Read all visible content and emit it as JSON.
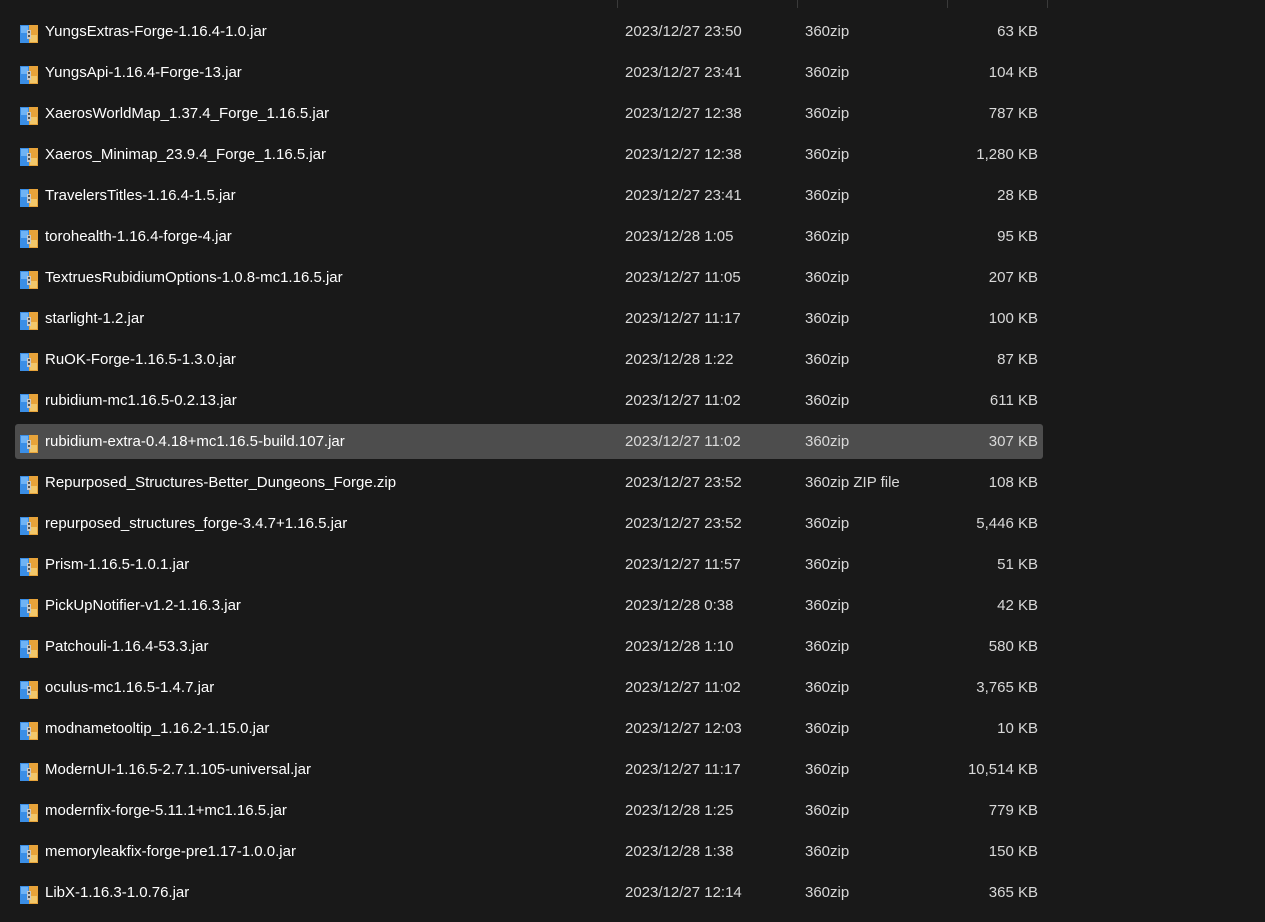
{
  "colors": {
    "background": "#191919",
    "selected_row": "#4d4d4d",
    "text_primary": "#ffffff",
    "text_secondary": "#d9d9d9"
  },
  "files": [
    {
      "name": "YungsExtras-Forge-1.16.4-1.0.jar",
      "date": "2023/12/27 23:50",
      "type": "360zip",
      "size": "63 KB",
      "icon": "archive-file-icon"
    },
    {
      "name": "YungsApi-1.16.4-Forge-13.jar",
      "date": "2023/12/27 23:41",
      "type": "360zip",
      "size": "104 KB",
      "icon": "archive-file-icon"
    },
    {
      "name": "XaerosWorldMap_1.37.4_Forge_1.16.5.jar",
      "date": "2023/12/27 12:38",
      "type": "360zip",
      "size": "787 KB",
      "icon": "archive-file-icon"
    },
    {
      "name": "Xaeros_Minimap_23.9.4_Forge_1.16.5.jar",
      "date": "2023/12/27 12:38",
      "type": "360zip",
      "size": "1,280 KB",
      "icon": "archive-file-icon"
    },
    {
      "name": "TravelersTitles-1.16.4-1.5.jar",
      "date": "2023/12/27 23:41",
      "type": "360zip",
      "size": "28 KB",
      "icon": "archive-file-icon"
    },
    {
      "name": "torohealth-1.16.4-forge-4.jar",
      "date": "2023/12/28 1:05",
      "type": "360zip",
      "size": "95 KB",
      "icon": "archive-file-icon"
    },
    {
      "name": "TextruesRubidiumOptions-1.0.8-mc1.16.5.jar",
      "date": "2023/12/27 11:05",
      "type": "360zip",
      "size": "207 KB",
      "icon": "archive-file-icon"
    },
    {
      "name": "starlight-1.2.jar",
      "date": "2023/12/27 11:17",
      "type": "360zip",
      "size": "100 KB",
      "icon": "archive-file-icon"
    },
    {
      "name": "RuOK-Forge-1.16.5-1.3.0.jar",
      "date": "2023/12/28 1:22",
      "type": "360zip",
      "size": "87 KB",
      "icon": "archive-file-icon"
    },
    {
      "name": "rubidium-mc1.16.5-0.2.13.jar",
      "date": "2023/12/27 11:02",
      "type": "360zip",
      "size": "611 KB",
      "icon": "archive-file-icon"
    },
    {
      "name": "rubidium-extra-0.4.18+mc1.16.5-build.107.jar",
      "date": "2023/12/27 11:02",
      "type": "360zip",
      "size": "307 KB",
      "icon": "archive-file-icon",
      "selected": true
    },
    {
      "name": "Repurposed_Structures-Better_Dungeons_Forge.zip",
      "date": "2023/12/27 23:52",
      "type": "360zip ZIP file",
      "size": "108 KB",
      "icon": "archive-file-icon"
    },
    {
      "name": "repurposed_structures_forge-3.4.7+1.16.5.jar",
      "date": "2023/12/27 23:52",
      "type": "360zip",
      "size": "5,446 KB",
      "icon": "archive-file-icon"
    },
    {
      "name": "Prism-1.16.5-1.0.1.jar",
      "date": "2023/12/27 11:57",
      "type": "360zip",
      "size": "51 KB",
      "icon": "archive-file-icon"
    },
    {
      "name": "PickUpNotifier-v1.2-1.16.3.jar",
      "date": "2023/12/28 0:38",
      "type": "360zip",
      "size": "42 KB",
      "icon": "archive-file-icon"
    },
    {
      "name": "Patchouli-1.16.4-53.3.jar",
      "date": "2023/12/28 1:10",
      "type": "360zip",
      "size": "580 KB",
      "icon": "archive-file-icon"
    },
    {
      "name": "oculus-mc1.16.5-1.4.7.jar",
      "date": "2023/12/27 11:02",
      "type": "360zip",
      "size": "3,765 KB",
      "icon": "archive-file-icon"
    },
    {
      "name": "modnametooltip_1.16.2-1.15.0.jar",
      "date": "2023/12/27 12:03",
      "type": "360zip",
      "size": "10 KB",
      "icon": "archive-file-icon"
    },
    {
      "name": "ModernUI-1.16.5-2.7.1.105-universal.jar",
      "date": "2023/12/27 11:17",
      "type": "360zip",
      "size": "10,514 KB",
      "icon": "archive-file-icon"
    },
    {
      "name": "modernfix-forge-5.11.1+mc1.16.5.jar",
      "date": "2023/12/28 1:25",
      "type": "360zip",
      "size": "779 KB",
      "icon": "archive-file-icon"
    },
    {
      "name": "memoryleakfix-forge-pre1.17-1.0.0.jar",
      "date": "2023/12/28 1:38",
      "type": "360zip",
      "size": "150 KB",
      "icon": "archive-file-icon"
    },
    {
      "name": "LibX-1.16.3-1.0.76.jar",
      "date": "2023/12/27 12:14",
      "type": "360zip",
      "size": "365 KB",
      "icon": "archive-file-icon"
    }
  ]
}
